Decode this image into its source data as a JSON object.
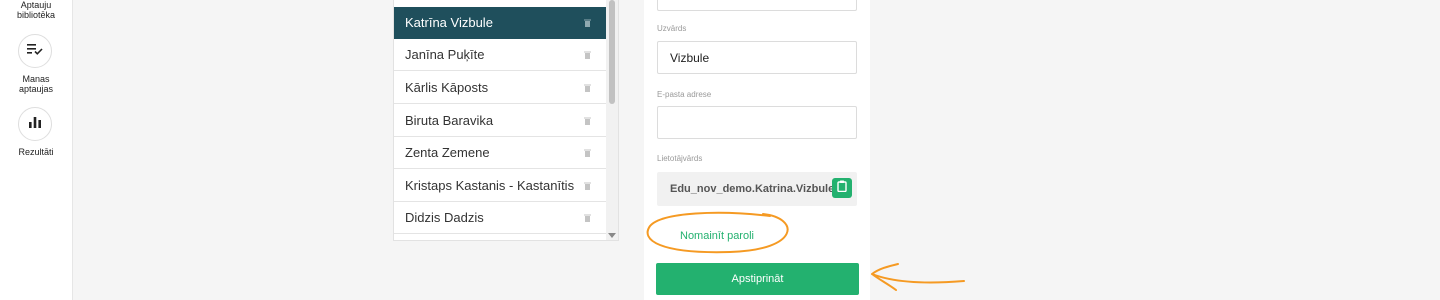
{
  "sidebar": {
    "items": [
      {
        "label": "Aptauju bibliotēka",
        "icon": "library-icon"
      },
      {
        "label": "Manas aptaujas",
        "icon": "checklist-icon"
      },
      {
        "label": "Rezultāti",
        "icon": "bar-chart-icon"
      }
    ]
  },
  "users": {
    "items": [
      {
        "name": "Katrīna Vizbule",
        "selected": true
      },
      {
        "name": "Janīna Puķīte",
        "selected": false
      },
      {
        "name": "Kārlis Kāposts",
        "selected": false
      },
      {
        "name": "Biruta Baravika",
        "selected": false
      },
      {
        "name": "Zenta Zemene",
        "selected": false
      },
      {
        "name": "Kristaps Kastanis - Kastanītis",
        "selected": false
      },
      {
        "name": "Didzis Dadzis",
        "selected": false
      }
    ]
  },
  "form": {
    "surname_label": "Uzvārds",
    "surname_value": "Vizbule",
    "email_label": "E-pasta adrese",
    "email_value": "",
    "username_label": "Lietotājvārds",
    "username_value": "Edu_nov_demo.Katrina.Vizbule",
    "change_password_label": "Nomainīt paroli",
    "confirm_label": "Apstiprināt"
  },
  "colors": {
    "accent_green": "#23b16f",
    "selected_row": "#1f4f5c",
    "annotation_orange": "#f59a23"
  }
}
